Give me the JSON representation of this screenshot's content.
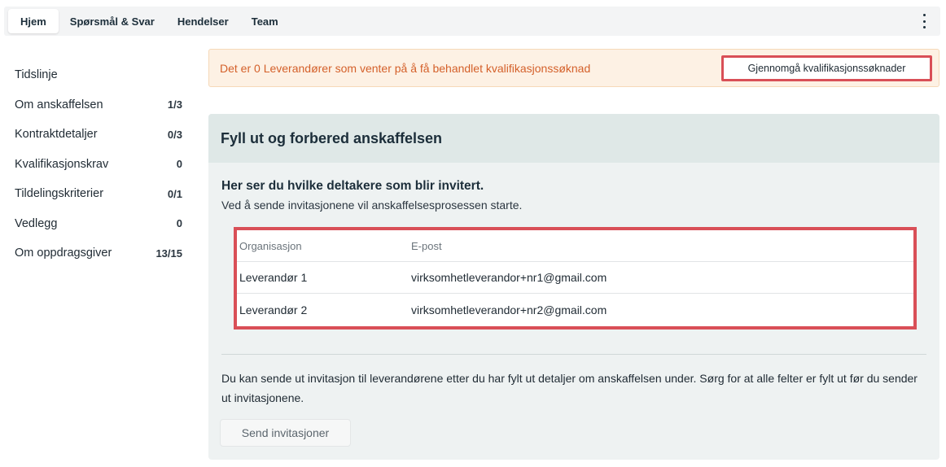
{
  "tabs": [
    {
      "label": "Hjem",
      "active": true
    },
    {
      "label": "Spørsmål & Svar",
      "active": false
    },
    {
      "label": "Hendelser",
      "active": false
    },
    {
      "label": "Team",
      "active": false
    }
  ],
  "sidebar": {
    "items": [
      {
        "label": "Tidslinje",
        "count": ""
      },
      {
        "label": "Om anskaffelsen",
        "count": "1/3"
      },
      {
        "label": "Kontraktdetaljer",
        "count": "0/3"
      },
      {
        "label": "Kvalifikasjonskrav",
        "count": "0"
      },
      {
        "label": "Tildelingskriterier",
        "count": "0/1"
      },
      {
        "label": "Vedlegg",
        "count": "0"
      },
      {
        "label": "Om oppdragsgiver",
        "count": "13/15"
      }
    ]
  },
  "banner": {
    "text": "Det er 0 Leverandører som venter på å få behandlet kvalifikasjonssøknad",
    "button_label": "Gjennomgå kvalifikasjonssøknader"
  },
  "card": {
    "title": "Fyll ut og forbered anskaffelsen",
    "section_title": "Her ser du hvilke deltakere som blir invitert.",
    "section_subtitle": "Ved å sende invitasjonene vil anskaffelsesprosessen starte.",
    "table": {
      "headers": [
        "Organisasjon",
        "E-post"
      ],
      "rows": [
        [
          "Leverandør 1",
          "virksomhetleverandor+nr1@gmail.com"
        ],
        [
          "Leverandør 2",
          "virksomhetleverandor+nr2@gmail.com"
        ]
      ]
    },
    "info_text": "Du kan sende ut invitasjon til leverandørene etter du har fylt ut detaljer om anskaffelsen under. Sørg for at alle felter er fylt ut før du sender ut invitasjonene.",
    "send_button_label": "Send invitasjoner"
  },
  "colors": {
    "banner_text": "#d4602a",
    "highlight_border": "#d94f57",
    "card_bg": "#eef2f2",
    "card_header_bg": "#dfe8e7"
  }
}
